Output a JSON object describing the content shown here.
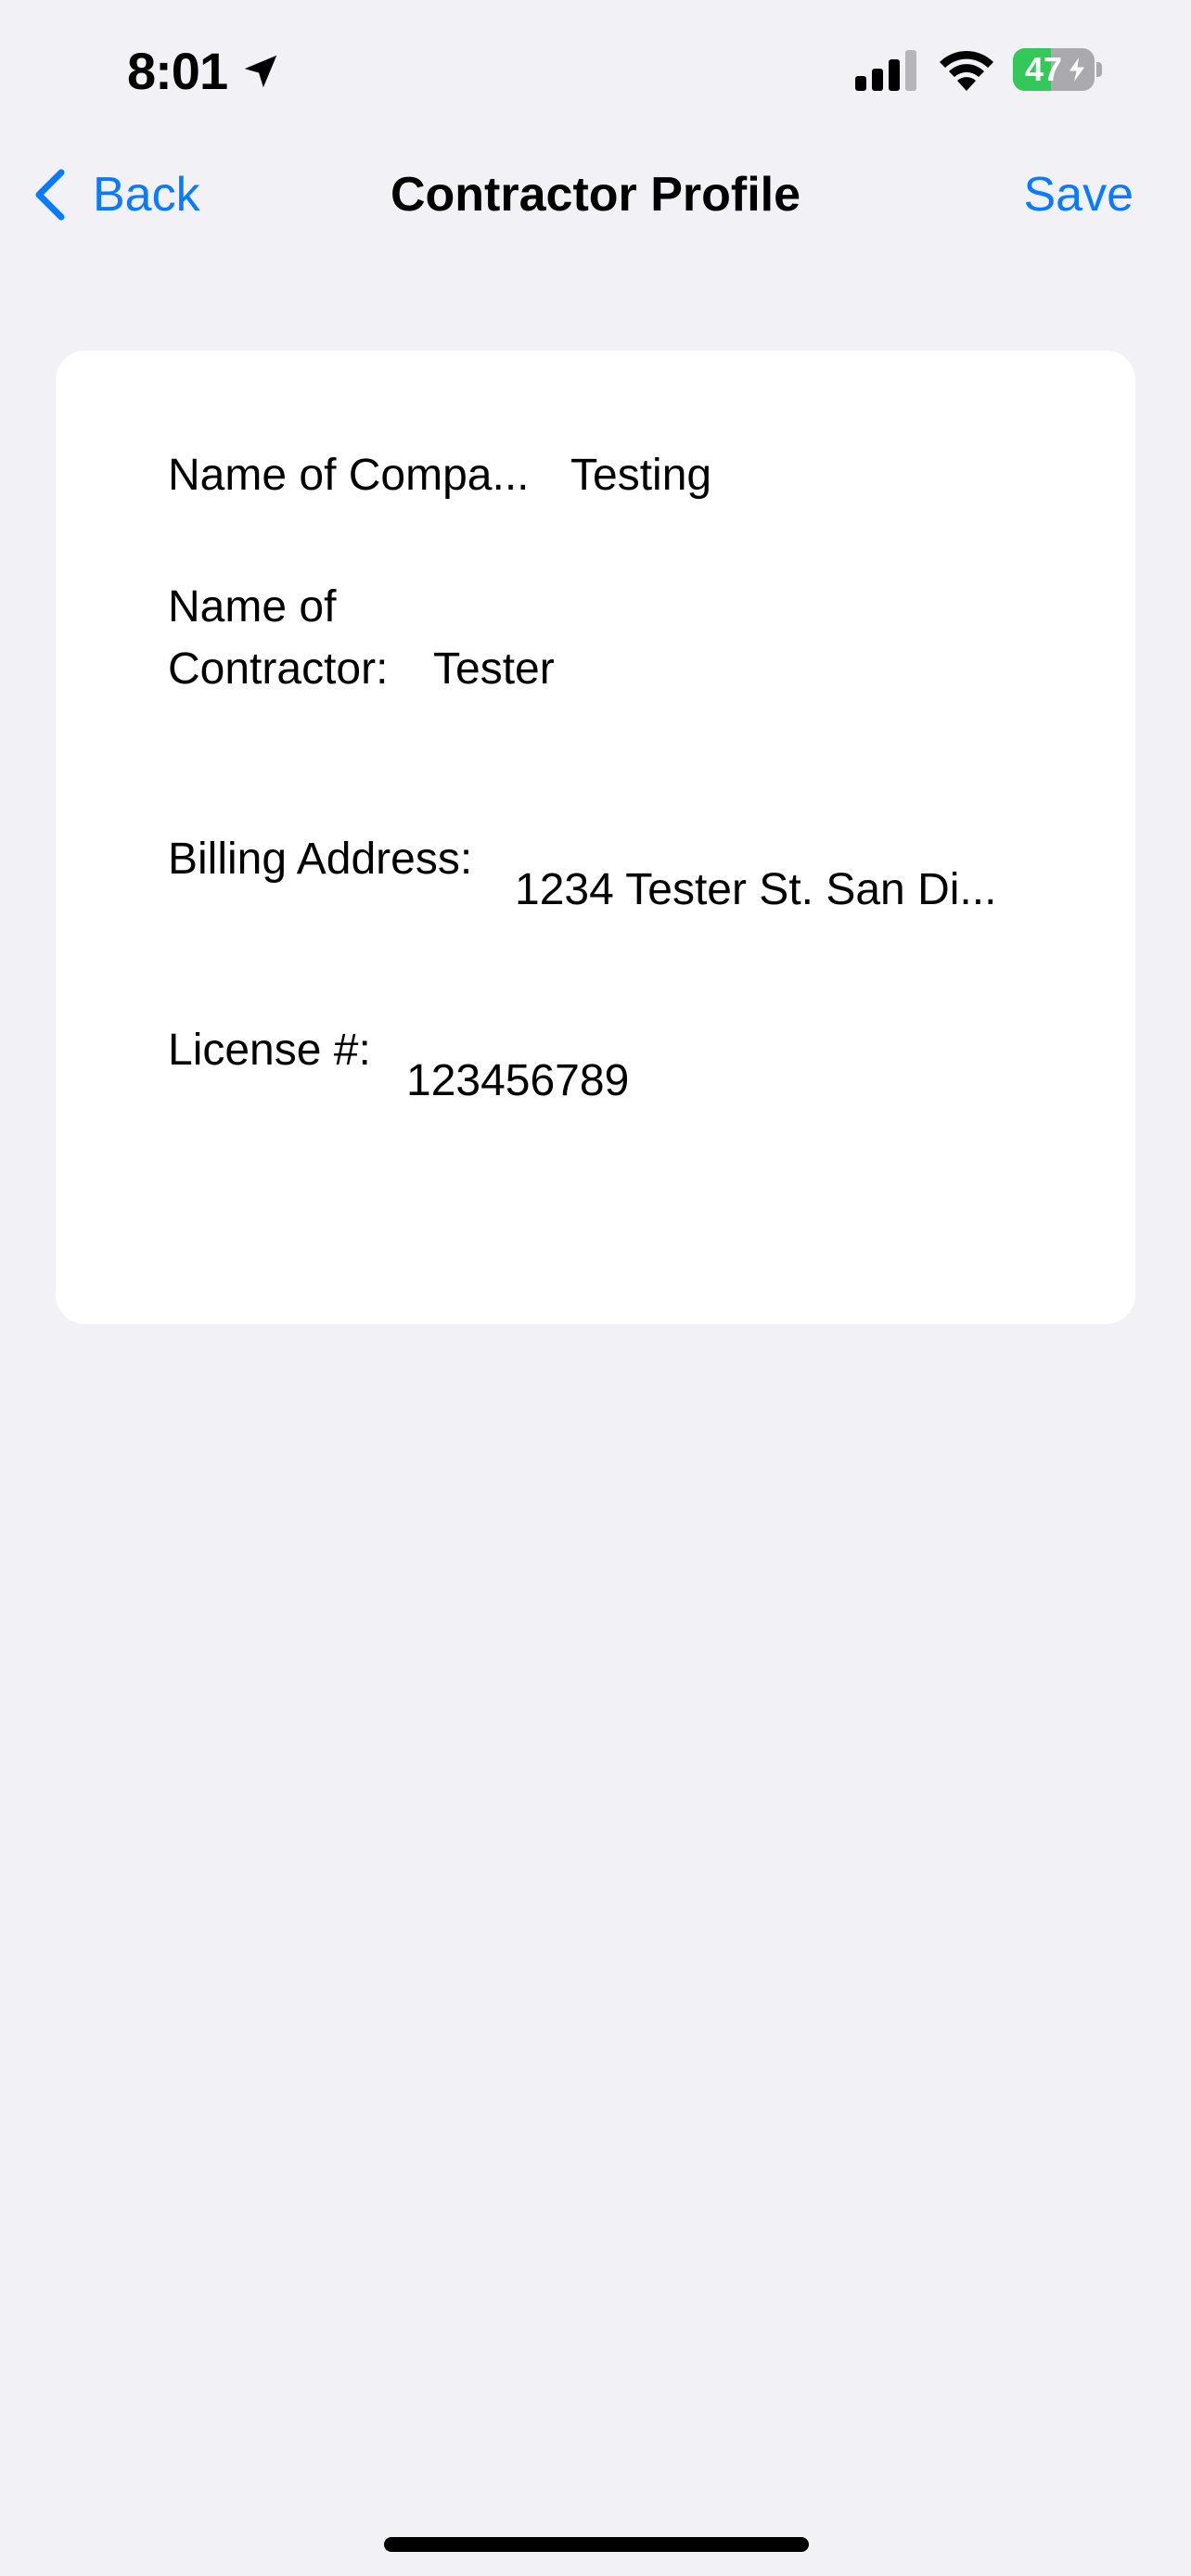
{
  "status_bar": {
    "time": "8:01",
    "battery_level": "47",
    "battery_fraction": 0.47,
    "location_icon": "location-arrow-icon",
    "signal_icon": "cellular-signal-icon",
    "wifi_icon": "wifi-icon",
    "charging_icon": "bolt-icon"
  },
  "nav": {
    "back_label": "Back",
    "title": "Contractor Profile",
    "save_label": "Save"
  },
  "form": {
    "company": {
      "label": "Name of Compa...",
      "value": "Testing"
    },
    "contractor": {
      "label_line1": "Name of",
      "label_line2": "Contractor:",
      "value": "Tester"
    },
    "billing": {
      "label": "Billing Address:",
      "value": "1234 Tester St. San Di..."
    },
    "license": {
      "label": "License #:",
      "value": "123456789"
    }
  },
  "colors": {
    "background": "#f1f1f6",
    "accent": "#0a7aff",
    "battery_green": "#34c759",
    "card": "#ffffff"
  }
}
